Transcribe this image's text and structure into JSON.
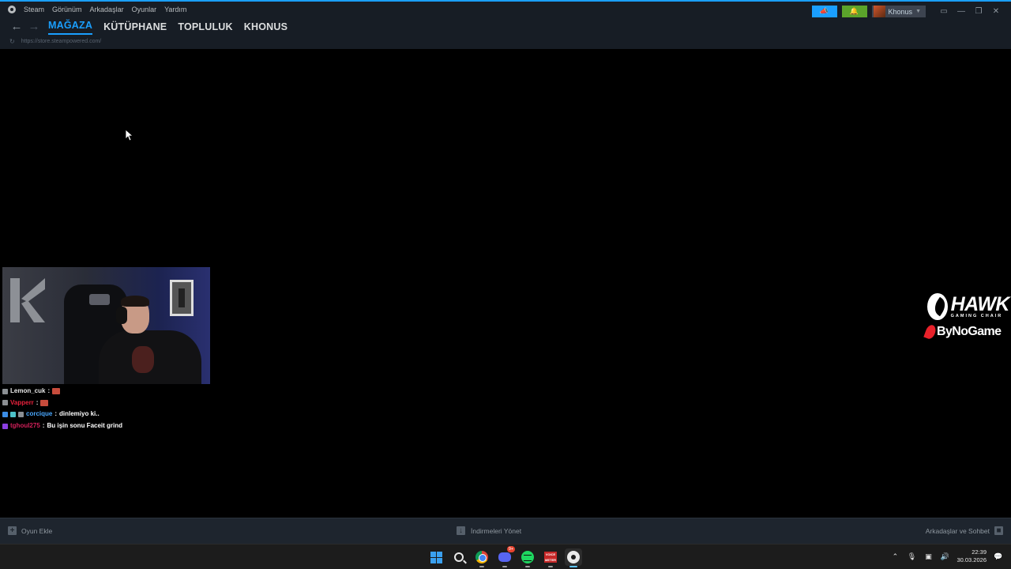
{
  "steam": {
    "menu": [
      "Steam",
      "Görünüm",
      "Arkadaşlar",
      "Oyunlar",
      "Yardım"
    ],
    "tabs": [
      "MAĞAZA",
      "KÜTÜPHANE",
      "TOPLULUK",
      "KHONUS"
    ],
    "active_tab": "MAĞAZA",
    "url": "https://store.steampowered.com/",
    "username": "Khonus",
    "accent_color": "#1a9fff",
    "notification_color": "#5ba32b"
  },
  "chat": [
    {
      "user": "Lemon_cuk",
      "sep": " :",
      "message": "",
      "badges": [
        "sword"
      ],
      "emote": true
    },
    {
      "user": "Vapperr",
      "sep": " :",
      "message": "",
      "badges": [
        "sword"
      ],
      "emote": true
    },
    {
      "user": "corcique",
      "sep": " :",
      "message": " dinlemiyo ki..",
      "badges": [
        "blue",
        "cyan",
        "sword"
      ],
      "emote": false
    },
    {
      "user": "tghoul275",
      "sep": " :",
      "message": " Bu işin sonu Faceit grind",
      "badges": [
        "purple"
      ],
      "emote": false
    }
  ],
  "sponsors": {
    "hawk_name": "HAWK",
    "hawk_sub": "GAMING CHAIR",
    "bynogame": "ByNoGame"
  },
  "bottombar": {
    "add_game": "Oyun Ekle",
    "downloads": "İndirmeleri Yönet",
    "friends": "Arkadaşlar ve Sohbet"
  },
  "taskbar": {
    "discord_badge": "9+",
    "voice_label": "VOICE METER",
    "time": "22:39",
    "date": "30.03.2026"
  }
}
